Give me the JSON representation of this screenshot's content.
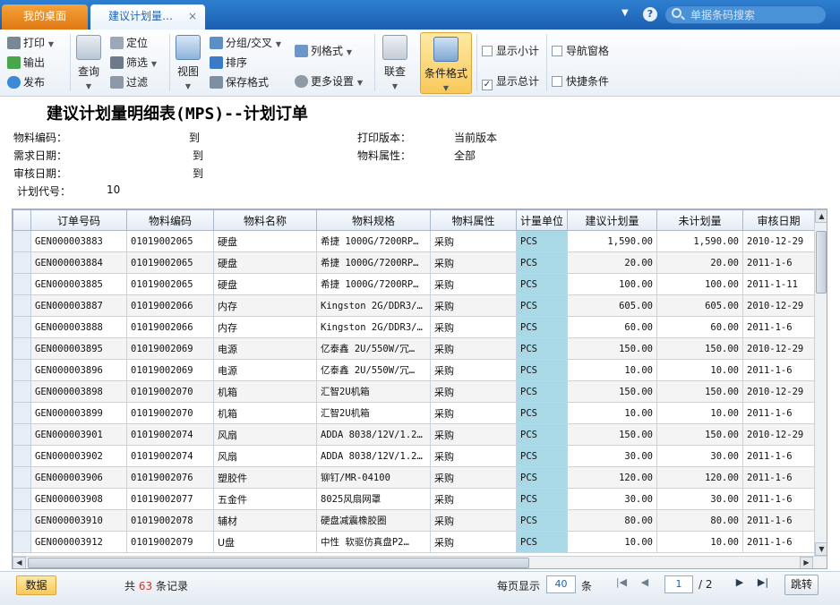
{
  "tabs": {
    "home": "我的桌面",
    "active": "建议计划量…",
    "close": "×"
  },
  "search": {
    "placeholder": "单据条码搜索"
  },
  "toolbar": {
    "print": "打印",
    "export": "输出",
    "publish": "发布",
    "query": "查询",
    "locate": "定位",
    "filter": "筛选",
    "filter2": "过滤",
    "view": "视图",
    "group_cross": "分组/交叉",
    "sort": "排序",
    "save_format": "保存格式",
    "column_format": "列格式",
    "more_settings": "更多设置",
    "link_query": "联查",
    "condition_format": "条件格式",
    "show_subtotal": "显示小计",
    "show_total": "显示总计",
    "nav_pane": "导航窗格",
    "quick_condition": "快捷条件"
  },
  "checks": {
    "show_subtotal": false,
    "show_total": true,
    "nav_pane": false,
    "quick_condition": false
  },
  "report": {
    "title": "建议计划量明细表(MPS)--计划订单",
    "material_code_label": "物料编码：",
    "material_code_to": "到",
    "demand_date_label": "需求日期：",
    "demand_date_to": "到",
    "audit_date_label": "审核日期：",
    "audit_date_to": "到",
    "plan_code_label": "计划代号：",
    "plan_code_value": "10",
    "print_version_label": "打印版本：",
    "print_version_value": "当前版本",
    "material_attr_label": "物料属性：",
    "material_attr_value": "全部"
  },
  "grid": {
    "columns": [
      "订单号码",
      "物料编码",
      "物料名称",
      "物料规格",
      "物料属性",
      "计量单位",
      "建议计划量",
      "未计划量",
      "审核日期"
    ],
    "rows": [
      [
        "GEN000003883",
        "01019002065",
        "硬盘",
        "希捷 1000G/7200RP…",
        "采购",
        "PCS",
        "1,590.00",
        "1,590.00",
        "2010-12-29"
      ],
      [
        "GEN000003884",
        "01019002065",
        "硬盘",
        "希捷 1000G/7200RP…",
        "采购",
        "PCS",
        "20.00",
        "20.00",
        "2011-1-6"
      ],
      [
        "GEN000003885",
        "01019002065",
        "硬盘",
        "希捷 1000G/7200RP…",
        "采购",
        "PCS",
        "100.00",
        "100.00",
        "2011-1-11"
      ],
      [
        "GEN000003887",
        "01019002066",
        "内存",
        "Kingston 2G/DDR3/…",
        "采购",
        "PCS",
        "605.00",
        "605.00",
        "2010-12-29"
      ],
      [
        "GEN000003888",
        "01019002066",
        "内存",
        "Kingston 2G/DDR3/…",
        "采购",
        "PCS",
        "60.00",
        "60.00",
        "2011-1-6"
      ],
      [
        "GEN000003895",
        "01019002069",
        "电源",
        "亿泰鑫 2U/550W/冗…",
        "采购",
        "PCS",
        "150.00",
        "150.00",
        "2010-12-29"
      ],
      [
        "GEN000003896",
        "01019002069",
        "电源",
        "亿泰鑫 2U/550W/冗…",
        "采购",
        "PCS",
        "10.00",
        "10.00",
        "2011-1-6"
      ],
      [
        "GEN000003898",
        "01019002070",
        "机箱",
        "汇智2U机箱",
        "采购",
        "PCS",
        "150.00",
        "150.00",
        "2010-12-29"
      ],
      [
        "GEN000003899",
        "01019002070",
        "机箱",
        "汇智2U机箱",
        "采购",
        "PCS",
        "10.00",
        "10.00",
        "2011-1-6"
      ],
      [
        "GEN000003901",
        "01019002074",
        "风扇",
        "ADDA 8038/12V/1.2…",
        "采购",
        "PCS",
        "150.00",
        "150.00",
        "2010-12-29"
      ],
      [
        "GEN000003902",
        "01019002074",
        "风扇",
        "ADDA 8038/12V/1.2…",
        "采购",
        "PCS",
        "30.00",
        "30.00",
        "2011-1-6"
      ],
      [
        "GEN000003906",
        "01019002076",
        "塑胶件",
        "铆钉/MR-04100",
        "采购",
        "PCS",
        "120.00",
        "120.00",
        "2011-1-6"
      ],
      [
        "GEN000003908",
        "01019002077",
        "五金件",
        "8025风扇网罩",
        "采购",
        "PCS",
        "30.00",
        "30.00",
        "2011-1-6"
      ],
      [
        "GEN000003910",
        "01019002078",
        "辅材",
        "硬盘减震橡胶圈",
        "采购",
        "PCS",
        "80.00",
        "80.00",
        "2011-1-6"
      ],
      [
        "GEN000003912",
        "01019002079",
        "U盘",
        "中性 软驱仿真盘P2…",
        "采购",
        "PCS",
        "10.00",
        "10.00",
        "2011-1-6"
      ]
    ]
  },
  "footer": {
    "data_tab": "数据",
    "total_prefix": "共",
    "total_count": "63",
    "total_suffix": "条记录",
    "per_page_label": "每页显示",
    "per_page_value": "40",
    "per_page_unit": "条",
    "current_page": "1",
    "total_pages": "/ 2",
    "jump": "跳转"
  },
  "colors": {
    "tabbar": "#1b5fb0",
    "home_tab": "#e07812",
    "highlight": "#f8c95a",
    "unit_column": "#a9d9e6"
  },
  "icons": [
    "search-icon",
    "help-icon",
    "print-icon",
    "export-icon",
    "publish-icon",
    "query-icon",
    "locate-icon",
    "filter-icon",
    "view-icon",
    "group-icon",
    "sort-icon",
    "save-icon",
    "column-icon",
    "settings-icon",
    "link-icon",
    "condition-format-icon"
  ]
}
